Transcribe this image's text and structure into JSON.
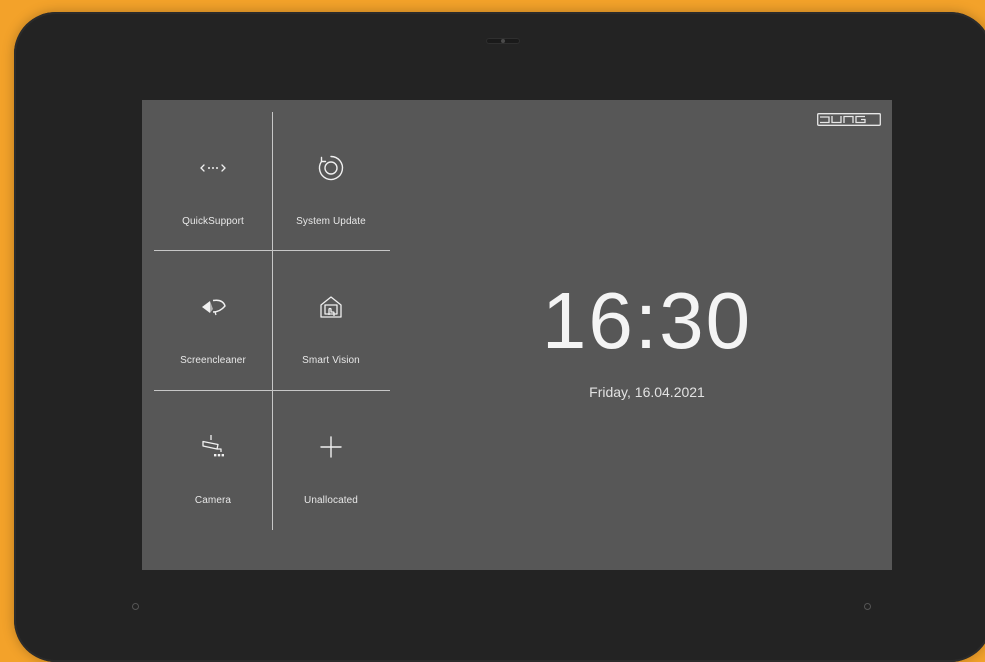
{
  "brand": {
    "logo_text": "JUNG"
  },
  "colors": {
    "background": "#f3a22a",
    "device": "#232323",
    "screen": "#575757",
    "text": "#e8e8e8"
  },
  "tiles": [
    {
      "label": "QuickSupport",
      "icon": "quick-support-icon"
    },
    {
      "label": "System Update",
      "icon": "system-update-icon"
    },
    {
      "label": "Screencleaner",
      "icon": "screencleaner-icon"
    },
    {
      "label": "Smart Vision",
      "icon": "smart-vision-icon"
    },
    {
      "label": "Camera",
      "icon": "camera-icon"
    },
    {
      "label": "Unallocated",
      "icon": "plus-icon"
    }
  ],
  "clock": {
    "time": "16:30",
    "date": "Friday, 16.04.2021"
  }
}
